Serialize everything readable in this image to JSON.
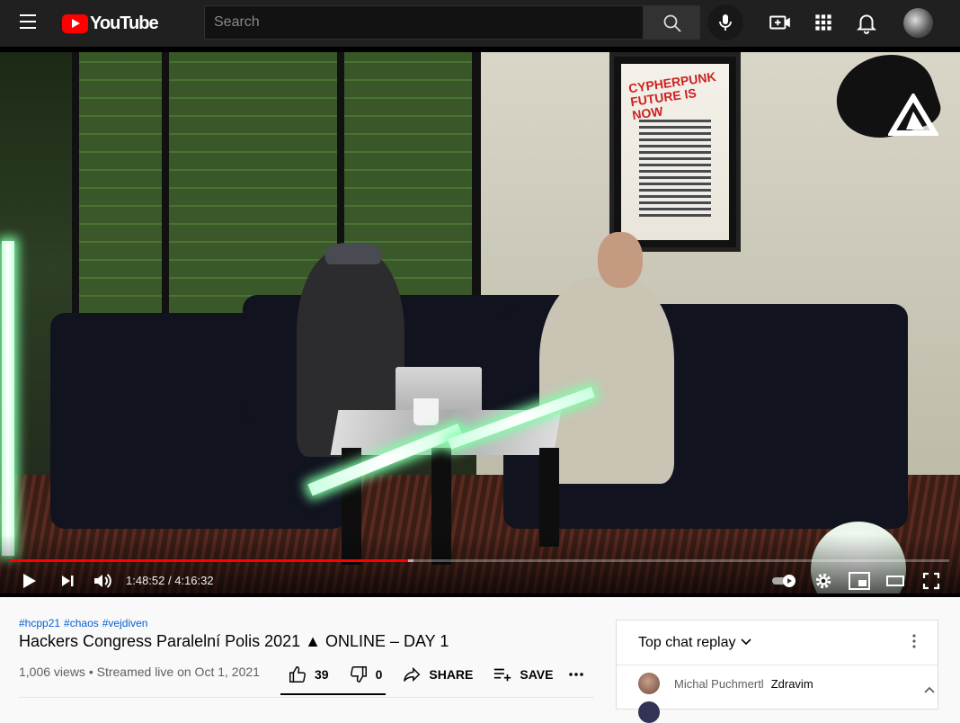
{
  "header": {
    "logo_text": "YouTube",
    "search_placeholder": "Search"
  },
  "player": {
    "current_time": "1:48:52",
    "duration": "4:16:32",
    "time_display": "1:48:52 / 4:16:32",
    "played_fraction": 0.4243,
    "loaded_fraction": 0.43,
    "poster_text": "CYPHERPUNK FUTURE IS NOW"
  },
  "video": {
    "hashtags": [
      "#hcpp21",
      "#chaos",
      "#vejdiven"
    ],
    "title": "Hackers Congress Paralelní Polis 2021 ▲ ONLINE – DAY 1",
    "views": "1,006 views",
    "streamed": "Streamed live on Oct 1, 2021",
    "meta_line": "1,006 views • Streamed live on Oct 1, 2021",
    "likes": "39",
    "dislikes": "0",
    "share_label": "SHARE",
    "save_label": "SAVE"
  },
  "chat": {
    "title": "Top chat replay",
    "messages": [
      {
        "author": "Michal Puchmertl",
        "text": "Zdravim"
      }
    ]
  },
  "colors": {
    "accent": "#ff0000",
    "link": "#065fd4",
    "topbar": "#202020"
  }
}
